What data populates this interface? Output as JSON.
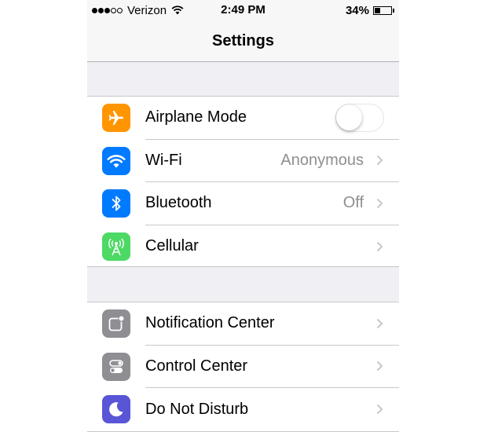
{
  "status_bar": {
    "signal_filled": 3,
    "signal_total": 5,
    "carrier": "Verizon",
    "wifi_icon": "wifi-icon",
    "time": "2:49 PM",
    "battery_percent": "34%",
    "battery_level": 0.34
  },
  "nav": {
    "title": "Settings"
  },
  "groups": [
    {
      "rows": [
        {
          "label": "Airplane Mode",
          "icon": "airplane-icon",
          "color": "#ff9500",
          "control": "toggle",
          "toggle_on": false
        },
        {
          "label": "Wi-Fi",
          "icon": "wifi-icon",
          "color": "#007aff",
          "value": "Anonymous"
        },
        {
          "label": "Bluetooth",
          "icon": "bluetooth-icon",
          "color": "#007aff",
          "value": "Off"
        },
        {
          "label": "Cellular",
          "icon": "cellular-icon",
          "color": "#4cd964",
          "value": ""
        }
      ]
    },
    {
      "rows": [
        {
          "label": "Notification Center",
          "icon": "notification-center-icon",
          "color": "#8e8e93"
        },
        {
          "label": "Control Center",
          "icon": "control-center-icon",
          "color": "#8e8e93"
        },
        {
          "label": "Do Not Disturb",
          "icon": "moon-icon",
          "color": "#5856d6"
        }
      ]
    }
  ],
  "colors": {
    "separator": "#c8c7cc",
    "background": "#efeff4",
    "value_text": "#8e8e93",
    "chevron": "#c7c7cc"
  }
}
